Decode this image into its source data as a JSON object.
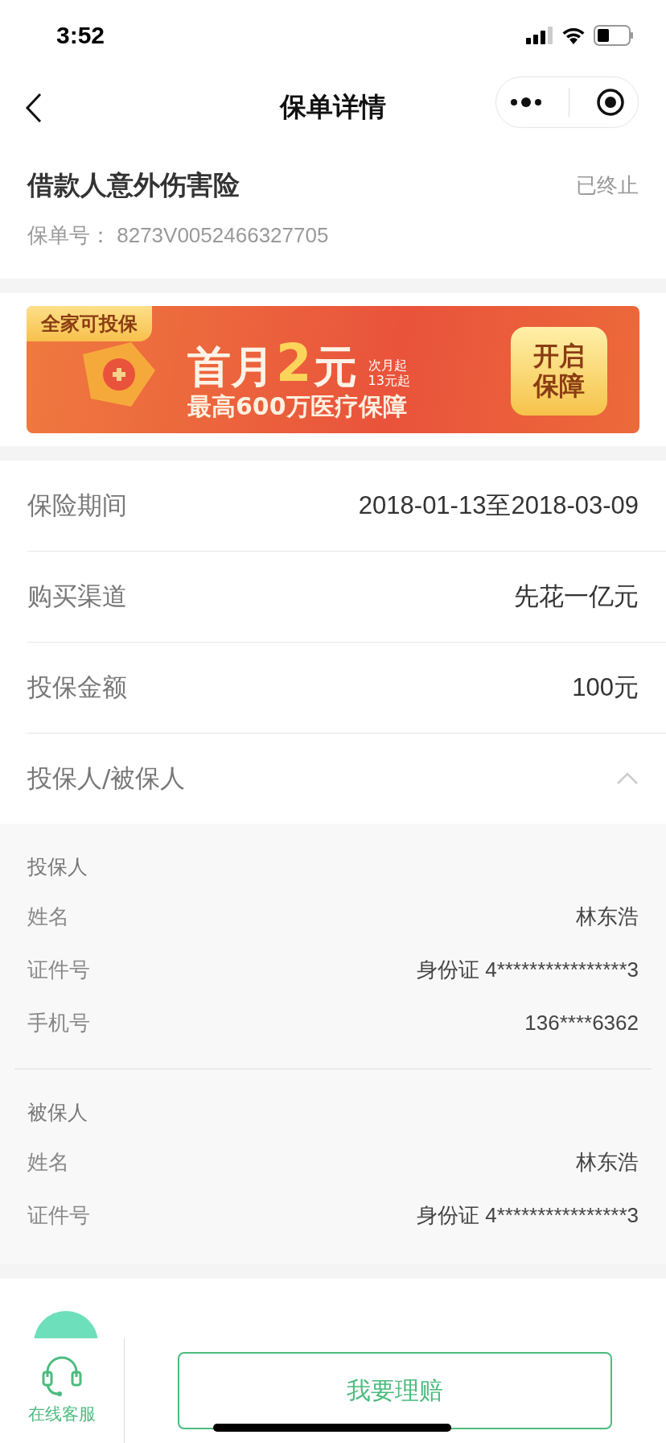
{
  "status_bar": {
    "time": "3:52"
  },
  "nav": {
    "title": "保单详情"
  },
  "policy": {
    "name": "借款人意外伤害险",
    "status": "已终止",
    "number_label": "保单号：",
    "number": "8273V0052466327705"
  },
  "banner": {
    "tag": "全家可投保",
    "headline_start": "首月",
    "headline_price": "2",
    "headline_end": "元",
    "note_lines": [
      "次月起",
      "13元起"
    ],
    "tagline": "最高600万医疗保障",
    "action": "开启保障"
  },
  "rows": [
    {
      "label": "保险期间",
      "value": "2018-01-13至2018-03-09"
    },
    {
      "label": "购买渠道",
      "value": "先花一亿元"
    },
    {
      "label": "投保金额",
      "value": "100元"
    }
  ],
  "parties": {
    "label": "投保人/被保人",
    "expanded": true,
    "groups": [
      {
        "title": "投保人",
        "fields": [
          {
            "label": "姓名",
            "value": "林东浩"
          },
          {
            "label": "证件号",
            "value": "身份证 4****************3"
          },
          {
            "label": "手机号",
            "value": "136****6362"
          }
        ]
      },
      {
        "title": "被保人",
        "fields": [
          {
            "label": "姓名",
            "value": "林东浩"
          },
          {
            "label": "证件号",
            "value": "身份证 4****************3"
          }
        ]
      }
    ]
  },
  "bottom_bar": {
    "service_label": "在线客服",
    "claim_button": "我要理赔"
  }
}
